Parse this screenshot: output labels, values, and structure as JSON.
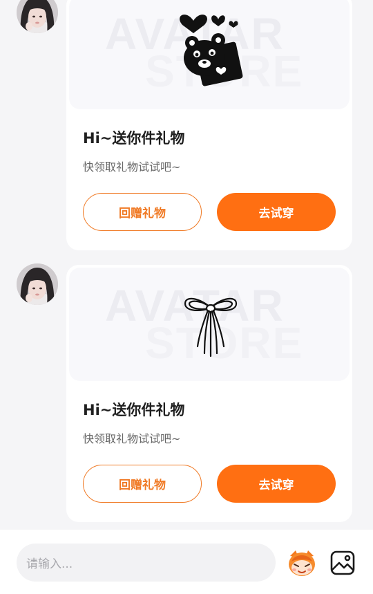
{
  "messages": [
    {
      "watermark_line1": "AVATAR",
      "watermark_line2": "STORE",
      "gift_icon": "bear-with-hearts-icon",
      "title": "Hi~送你件礼物",
      "subtitle": "快领取礼物试试吧~",
      "btn_return": "回赠礼物",
      "btn_try": "去试穿"
    },
    {
      "watermark_line1": "AVATAR",
      "watermark_line2": "STORE",
      "gift_icon": "ribbon-bow-icon",
      "title": "Hi~送你件礼物",
      "subtitle": "快领取礼物试试吧~",
      "btn_return": "回赠礼物",
      "btn_try": "去试穿"
    }
  ],
  "input": {
    "placeholder": "请输入...",
    "left_icon": "mascot-sticker-icon",
    "right_icon": "image-icon"
  },
  "colors": {
    "accent": "#ff6f12",
    "accent_outline": "#f07a25",
    "background": "#f5f5f7",
    "card": "#ffffff"
  }
}
